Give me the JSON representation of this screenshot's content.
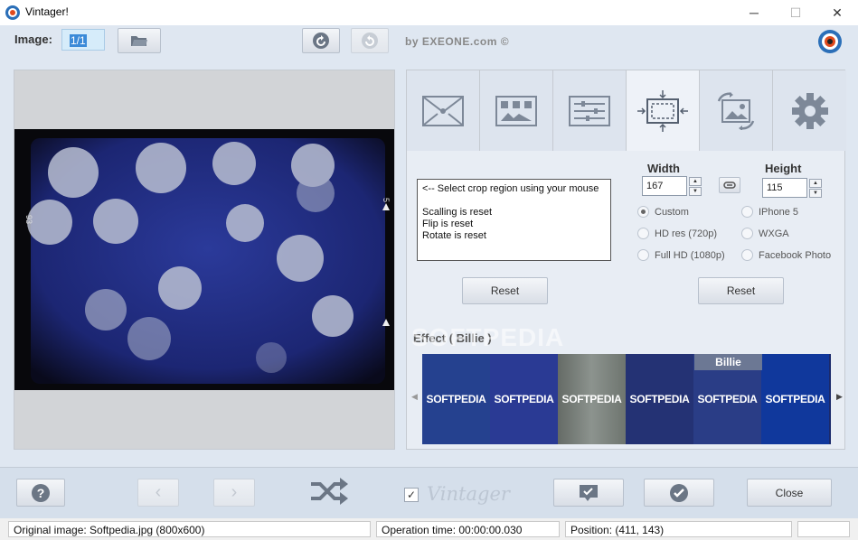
{
  "window": {
    "title": "Vintager!",
    "minimize_glyph": "─",
    "maximize_glyph": "☐",
    "close_glyph": "✕"
  },
  "toolbar": {
    "image_label": "Image:",
    "image_value": "1/1",
    "by_label": "by EXEONE.com ©"
  },
  "crop": {
    "info_lines": [
      "<-- Select crop region using your mouse",
      "",
      "Scalling is reset",
      "Flip is reset",
      "Rotate is reset"
    ],
    "width_label": "Width",
    "width_value": "167",
    "height_label": "Height",
    "height_value": "115",
    "presets": [
      {
        "label": "Custom",
        "selected": true
      },
      {
        "label": "IPhone 5",
        "selected": false
      },
      {
        "label": "HD res (720p)",
        "selected": false
      },
      {
        "label": "WXGA",
        "selected": false
      },
      {
        "label": "Full HD (1080p)",
        "selected": false
      },
      {
        "label": "Facebook Photo",
        "selected": false
      }
    ],
    "reset_left": "Reset",
    "reset_right": "Reset"
  },
  "preview": {
    "frame_mark_left": "93",
    "frame_mark_right": "5"
  },
  "effect": {
    "label": "Effect ( Billie )",
    "tiles": [
      "SOFTPEDIA",
      "SOFTPEDIA",
      "SOFTPEDIA",
      "SOFTPEDIA",
      "SOFTPEDIA",
      "SOFTPEDIA"
    ],
    "selected_name": "Billie",
    "watermark": "SOFTPEDIA"
  },
  "bottom": {
    "vintager_logo": "Vintager",
    "close_label": "Close"
  },
  "status": {
    "original": "Original image: Softpedia.jpg (800x600)",
    "operation_time": "Operation time: 00:00:00.030",
    "position": "Position: (411, 143)"
  }
}
